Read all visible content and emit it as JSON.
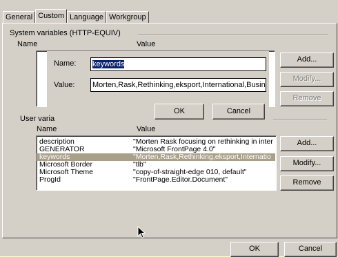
{
  "tabs": [
    "General",
    "Custom",
    "Language",
    "Workgroup"
  ],
  "system": {
    "group_label": "System variables (HTTP-EQUIV)",
    "col_name": "Name",
    "col_value": "Value",
    "add": "Add...",
    "modify": "Modify...",
    "remove": "Remove"
  },
  "edit_dialog": {
    "name_label": "Name:",
    "name_value": "keywords",
    "value_label": "Value:",
    "value_value": "Morten,Rask,Rethinking,eksport,International,Busine",
    "ok": "OK",
    "cancel": "Cancel"
  },
  "user": {
    "group_label": "User varia",
    "col_name": "Name",
    "col_value": "Value",
    "add": "Add...",
    "modify": "Modify...",
    "remove": "Remove",
    "rows": [
      {
        "name": "description",
        "value": "\"Morten Rask focusing on rethinking in inter"
      },
      {
        "name": "GENERATOR",
        "value": "\"Microsoft FrontPage 4.0\""
      },
      {
        "name": "keywords",
        "value": "\"Morten,Rask,Rethinking,eksport,Internatio"
      },
      {
        "name": "Microsoft Border",
        "value": "\"tlb\""
      },
      {
        "name": "Microsoft Theme",
        "value": "\"copy-of-straight-edge 010, default\""
      },
      {
        "name": "ProgId",
        "value": "\"FrontPage.Editor.Document\""
      }
    ],
    "selected_row": 2
  },
  "footer": {
    "ok": "OK",
    "cancel": "Cancel"
  }
}
